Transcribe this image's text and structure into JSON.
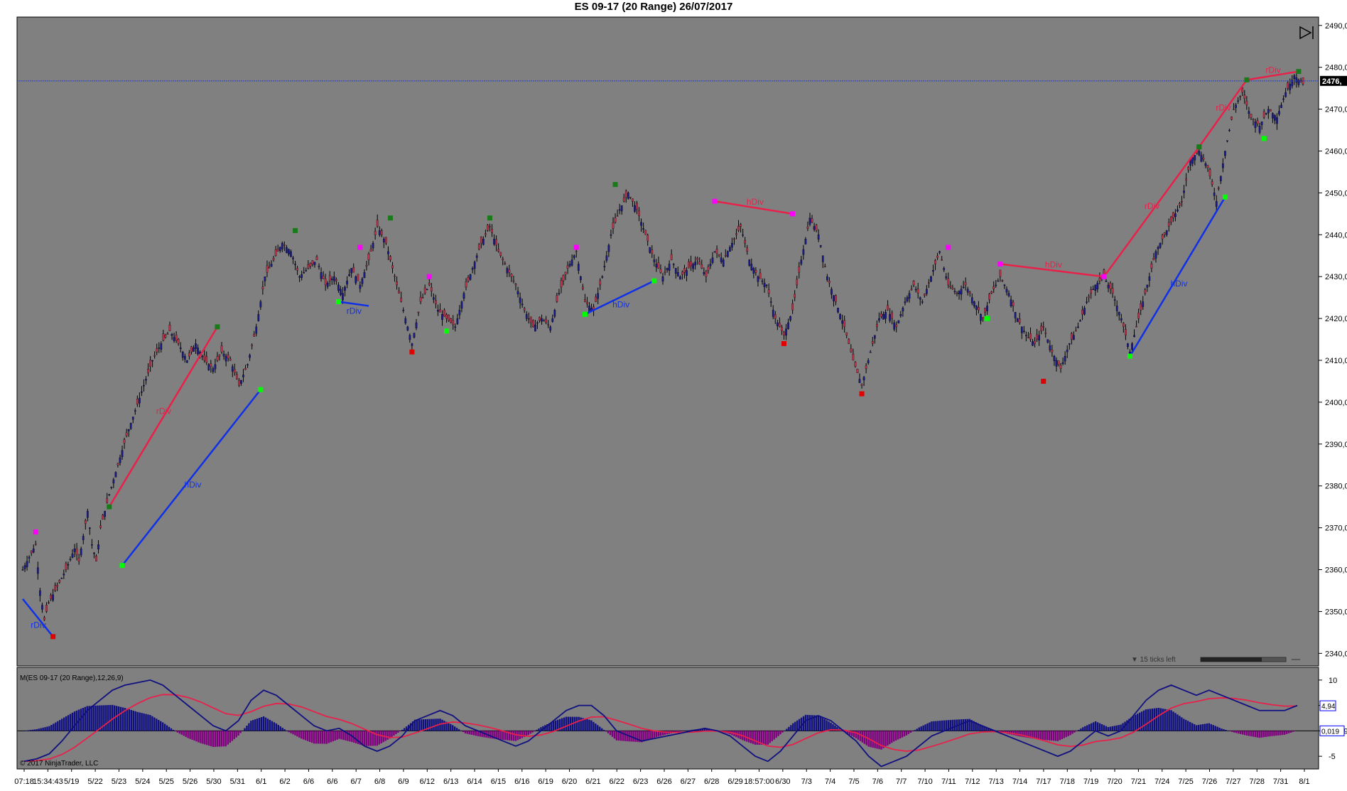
{
  "title": "ES 09-17 (20 Range)  26/07/2017",
  "colors": {
    "panel_bg": "#808080",
    "price_line": "#1f3fd0",
    "bull_div": "#e8204a",
    "bear_div": "#1030e8",
    "green_dot": "#1a7a1a",
    "lime_dot": "#00ff00",
    "red_dot": "#e00000",
    "magenta_dot": "#ff00ff",
    "histogram_pos": "#101080",
    "histogram_neg": "#800080",
    "macd_line": "#101080",
    "signal_line": "#e8204a"
  },
  "ui": {
    "ticks_left": "▼ 15 ticks left",
    "copyright": "© 2017 NinjaTrader, LLC",
    "indicator_label": "M(ES 09-17 (20 Range),12,26,9)",
    "scroll_end_icon": "scroll-to-end-icon"
  },
  "chart_data": [
    {
      "type": "candlestick",
      "title": "ES 09-17 (20 Range)  26/07/2017",
      "ylim": [
        2337,
        2492
      ],
      "y_ticks": [
        "2340,00",
        "2350,00",
        "2360,00",
        "2370,00",
        "2380,00",
        "2390,00",
        "2400,00",
        "2410,00",
        "2420,00",
        "2430,00",
        "2440,00",
        "2450,00",
        "2460,00",
        "2470,00",
        "2480,00",
        "2490,00"
      ],
      "y_tick_values": [
        2340,
        2350,
        2360,
        2370,
        2380,
        2390,
        2400,
        2410,
        2420,
        2430,
        2440,
        2450,
        2460,
        2470,
        2480,
        2490
      ],
      "last_price_label": "2476,",
      "last_price": 2476.75,
      "x_tick_labels": [
        "07:18",
        "15:34:43",
        "5/19",
        "5/22",
        "5/23",
        "5/24",
        "5/25",
        "5/26",
        "5/30",
        "5/31",
        "6/1",
        "6/2",
        "6/6",
        "6/6",
        "6/7",
        "6/8",
        "6/9",
        "6/12",
        "6/13",
        "6/14",
        "6/15",
        "6/16",
        "6/19",
        "6/20",
        "6/21",
        "6/22",
        "6/23",
        "6/26",
        "6/27",
        "6/28",
        "6/29",
        "18:57:00",
        "6/30",
        "7/3",
        "7/4",
        "7/5",
        "7/6",
        "7/7",
        "7/10",
        "7/11",
        "7/12",
        "7/13",
        "7/14",
        "7/17",
        "7/18",
        "7/19",
        "7/20",
        "7/21",
        "7/24",
        "7/25",
        "7/26",
        "7/27",
        "7/28",
        "7/31",
        "8/1"
      ],
      "price_path": [
        [
          0,
          2360
        ],
        [
          1,
          2362
        ],
        [
          3,
          2366
        ],
        [
          4,
          2355
        ],
        [
          5,
          2348
        ],
        [
          6,
          2352
        ],
        [
          8,
          2356
        ],
        [
          10,
          2360
        ],
        [
          12,
          2365
        ],
        [
          13,
          2362
        ],
        [
          14,
          2368
        ],
        [
          15,
          2374
        ],
        [
          16,
          2366
        ],
        [
          17,
          2362
        ],
        [
          18,
          2370
        ],
        [
          20,
          2378
        ],
        [
          22,
          2385
        ],
        [
          24,
          2392
        ],
        [
          26,
          2398
        ],
        [
          28,
          2404
        ],
        [
          30,
          2410
        ],
        [
          32,
          2414
        ],
        [
          34,
          2417
        ],
        [
          36,
          2414
        ],
        [
          38,
          2410
        ],
        [
          40,
          2414
        ],
        [
          42,
          2410
        ],
        [
          44,
          2408
        ],
        [
          46,
          2412
        ],
        [
          48,
          2410
        ],
        [
          50,
          2404
        ],
        [
          52,
          2409
        ],
        [
          54,
          2418
        ],
        [
          56,
          2430
        ],
        [
          58,
          2434
        ],
        [
          60,
          2438
        ],
        [
          62,
          2436
        ],
        [
          64,
          2430
        ],
        [
          66,
          2432
        ],
        [
          68,
          2434
        ],
        [
          70,
          2428
        ],
        [
          72,
          2430
        ],
        [
          74,
          2426
        ],
        [
          76,
          2432
        ],
        [
          78,
          2428
        ],
        [
          80,
          2434
        ],
        [
          82,
          2442
        ],
        [
          84,
          2438
        ],
        [
          86,
          2430
        ],
        [
          88,
          2422
        ],
        [
          90,
          2414
        ],
        [
          92,
          2424
        ],
        [
          94,
          2428
        ],
        [
          96,
          2422
        ],
        [
          98,
          2420
        ],
        [
          100,
          2418
        ],
        [
          102,
          2426
        ],
        [
          104,
          2432
        ],
        [
          106,
          2438
        ],
        [
          108,
          2442
        ],
        [
          110,
          2436
        ],
        [
          112,
          2432
        ],
        [
          114,
          2428
        ],
        [
          116,
          2422
        ],
        [
          118,
          2418
        ],
        [
          120,
          2420
        ],
        [
          122,
          2418
        ],
        [
          124,
          2426
        ],
        [
          126,
          2432
        ],
        [
          128,
          2436
        ],
        [
          130,
          2424
        ],
        [
          132,
          2422
        ],
        [
          134,
          2430
        ],
        [
          136,
          2440
        ],
        [
          138,
          2446
        ],
        [
          140,
          2450
        ],
        [
          142,
          2446
        ],
        [
          144,
          2440
        ],
        [
          146,
          2434
        ],
        [
          148,
          2430
        ],
        [
          150,
          2434
        ],
        [
          152,
          2430
        ],
        [
          154,
          2432
        ],
        [
          156,
          2434
        ],
        [
          158,
          2430
        ],
        [
          160,
          2436
        ],
        [
          162,
          2434
        ],
        [
          164,
          2438
        ],
        [
          166,
          2442
        ],
        [
          168,
          2434
        ],
        [
          170,
          2430
        ],
        [
          172,
          2428
        ],
        [
          174,
          2420
        ],
        [
          176,
          2416
        ],
        [
          178,
          2422
        ],
        [
          180,
          2434
        ],
        [
          182,
          2444
        ],
        [
          184,
          2440
        ],
        [
          186,
          2430
        ],
        [
          188,
          2424
        ],
        [
          190,
          2418
        ],
        [
          192,
          2410
        ],
        [
          194,
          2404
        ],
        [
          196,
          2412
        ],
        [
          198,
          2420
        ],
        [
          200,
          2422
        ],
        [
          202,
          2418
        ],
        [
          204,
          2424
        ],
        [
          206,
          2428
        ],
        [
          208,
          2424
        ],
        [
          210,
          2430
        ],
        [
          212,
          2436
        ],
        [
          214,
          2428
        ],
        [
          216,
          2426
        ],
        [
          218,
          2428
        ],
        [
          220,
          2424
        ],
        [
          222,
          2420
        ],
        [
          224,
          2426
        ],
        [
          226,
          2430
        ],
        [
          228,
          2426
        ],
        [
          230,
          2420
        ],
        [
          232,
          2416
        ],
        [
          234,
          2414
        ],
        [
          236,
          2418
        ],
        [
          238,
          2412
        ],
        [
          240,
          2408
        ],
        [
          242,
          2414
        ],
        [
          244,
          2418
        ],
        [
          246,
          2424
        ],
        [
          248,
          2428
        ],
        [
          250,
          2430
        ],
        [
          252,
          2426
        ],
        [
          254,
          2420
        ],
        [
          256,
          2412
        ],
        [
          258,
          2420
        ],
        [
          260,
          2428
        ],
        [
          262,
          2436
        ],
        [
          264,
          2440
        ],
        [
          266,
          2444
        ],
        [
          268,
          2448
        ],
        [
          270,
          2458
        ],
        [
          272,
          2460
        ],
        [
          274,
          2456
        ],
        [
          276,
          2448
        ],
        [
          278,
          2460
        ],
        [
          280,
          2470
        ],
        [
          282,
          2474
        ],
        [
          284,
          2468
        ],
        [
          286,
          2466
        ],
        [
          288,
          2470
        ],
        [
          290,
          2468
        ],
        [
          292,
          2474
        ],
        [
          294,
          2478
        ],
        [
          296,
          2476
        ]
      ],
      "pivot_markers": [
        {
          "i": 3,
          "price": 2369,
          "color": "magenta"
        },
        {
          "i": 7,
          "price": 2344,
          "color": "red"
        },
        {
          "i": 20,
          "price": 2375,
          "color": "green"
        },
        {
          "i": 23,
          "price": 2361,
          "color": "lime"
        },
        {
          "i": 45,
          "price": 2418,
          "color": "green"
        },
        {
          "i": 55,
          "price": 2403,
          "color": "lime"
        },
        {
          "i": 63,
          "price": 2441,
          "color": "green"
        },
        {
          "i": 73,
          "price": 2424,
          "color": "lime"
        },
        {
          "i": 78,
          "price": 2437,
          "color": "magenta"
        },
        {
          "i": 85,
          "price": 2444,
          "color": "green"
        },
        {
          "i": 90,
          "price": 2412,
          "color": "red"
        },
        {
          "i": 94,
          "price": 2430,
          "color": "magenta"
        },
        {
          "i": 98,
          "price": 2417,
          "color": "lime"
        },
        {
          "i": 108,
          "price": 2444,
          "color": "green"
        },
        {
          "i": 128,
          "price": 2437,
          "color": "magenta"
        },
        {
          "i": 130,
          "price": 2421,
          "color": "lime"
        },
        {
          "i": 137,
          "price": 2452,
          "color": "green"
        },
        {
          "i": 146,
          "price": 2429,
          "color": "lime"
        },
        {
          "i": 160,
          "price": 2448,
          "color": "magenta"
        },
        {
          "i": 178,
          "price": 2445,
          "color": "magenta"
        },
        {
          "i": 176,
          "price": 2414,
          "color": "red"
        },
        {
          "i": 194,
          "price": 2402,
          "color": "red"
        },
        {
          "i": 214,
          "price": 2437,
          "color": "magenta"
        },
        {
          "i": 223,
          "price": 2420,
          "color": "lime"
        },
        {
          "i": 226,
          "price": 2433,
          "color": "magenta"
        },
        {
          "i": 236,
          "price": 2405,
          "color": "red"
        },
        {
          "i": 250,
          "price": 2430,
          "color": "magenta"
        },
        {
          "i": 256,
          "price": 2411,
          "color": "lime"
        },
        {
          "i": 272,
          "price": 2461,
          "color": "green"
        },
        {
          "i": 278,
          "price": 2449,
          "color": "lime"
        },
        {
          "i": 283,
          "price": 2477,
          "color": "green"
        },
        {
          "i": 287,
          "price": 2463,
          "color": "lime"
        },
        {
          "i": 295,
          "price": 2479,
          "color": "green"
        }
      ],
      "divergence_lines": [
        {
          "label": "rDiv",
          "color": "bear",
          "from": [
            0,
            2353
          ],
          "to": [
            7,
            2344
          ]
        },
        {
          "label": "rDiv",
          "color": "bull",
          "from": [
            20,
            2375
          ],
          "to": [
            45,
            2418
          ]
        },
        {
          "label": "hDiv",
          "color": "bear",
          "from": [
            23,
            2361
          ],
          "to": [
            55,
            2403
          ]
        },
        {
          "label": "rDiv",
          "color": "bear",
          "from": [
            73,
            2424
          ],
          "to": [
            80,
            2423
          ]
        },
        {
          "label": "hDiv",
          "color": "bear",
          "from": [
            130,
            2421
          ],
          "to": [
            146,
            2429
          ]
        },
        {
          "label": "hDiv",
          "color": "bull",
          "from": [
            160,
            2448
          ],
          "to": [
            178,
            2445
          ]
        },
        {
          "label": "hDiv",
          "color": "bull",
          "from": [
            226,
            2433
          ],
          "to": [
            250,
            2430
          ]
        },
        {
          "label": "rDiv",
          "color": "bull",
          "from": [
            250,
            2430
          ],
          "to": [
            272,
            2461
          ]
        },
        {
          "label": "hDiv",
          "color": "bear",
          "from": [
            256,
            2411
          ],
          "to": [
            278,
            2449
          ]
        },
        {
          "label": "rDiv",
          "color": "bull",
          "from": [
            272,
            2461
          ],
          "to": [
            283,
            2477
          ]
        },
        {
          "label": "rDiv",
          "color": "bull",
          "from": [
            283,
            2477
          ],
          "to": [
            295,
            2479
          ]
        }
      ]
    },
    {
      "type": "macd",
      "title": "M(ES 09-17 (20 Range),12,26,9)",
      "ylim": [
        -7.5,
        12.5
      ],
      "y_ticks": [
        "10",
        "5",
        "0,019",
        "-5"
      ],
      "y_tick_values": [
        10,
        5,
        0,
        -5
      ],
      "current_value_label": "4,94",
      "current_value": 4.94,
      "zero_label": "0,019",
      "macd": [
        -6,
        -5.5,
        -4.5,
        -2,
        1,
        4,
        6,
        8,
        9,
        9.5,
        10,
        9,
        7,
        5,
        3,
        1,
        0,
        2,
        6,
        8,
        7,
        5,
        3,
        1,
        0,
        0.5,
        -1,
        -3,
        -4,
        -3,
        -1,
        2,
        3,
        4,
        3,
        1,
        0,
        -1,
        -2,
        -3,
        -2,
        0,
        2,
        4,
        5,
        5,
        3,
        0,
        -1,
        -2,
        -1.5,
        -1,
        -0.5,
        0,
        0.5,
        0,
        -1,
        -3,
        -5,
        -6,
        -4,
        -1,
        2,
        3,
        2,
        0,
        -2,
        -5,
        -7,
        -6,
        -5,
        -3,
        -1,
        0,
        1,
        2,
        1,
        0,
        -1,
        -2,
        -3,
        -4,
        -5,
        -4,
        -2,
        0,
        -1,
        0,
        3,
        6,
        8,
        9,
        8,
        7,
        8,
        7,
        6,
        5,
        4,
        4,
        4,
        5
      ]
    }
  ]
}
